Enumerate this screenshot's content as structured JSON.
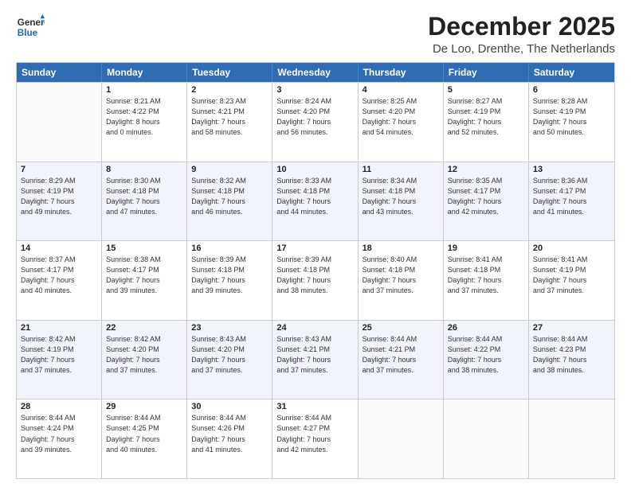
{
  "header": {
    "logo_general": "General",
    "logo_blue": "Blue",
    "title": "December 2025",
    "subtitle": "De Loo, Drenthe, The Netherlands"
  },
  "days_of_week": [
    "Sunday",
    "Monday",
    "Tuesday",
    "Wednesday",
    "Thursday",
    "Friday",
    "Saturday"
  ],
  "weeks": [
    [
      {
        "day": "",
        "info": ""
      },
      {
        "day": "1",
        "info": "Sunrise: 8:21 AM\nSunset: 4:22 PM\nDaylight: 8 hours\nand 0 minutes."
      },
      {
        "day": "2",
        "info": "Sunrise: 8:23 AM\nSunset: 4:21 PM\nDaylight: 7 hours\nand 58 minutes."
      },
      {
        "day": "3",
        "info": "Sunrise: 8:24 AM\nSunset: 4:20 PM\nDaylight: 7 hours\nand 56 minutes."
      },
      {
        "day": "4",
        "info": "Sunrise: 8:25 AM\nSunset: 4:20 PM\nDaylight: 7 hours\nand 54 minutes."
      },
      {
        "day": "5",
        "info": "Sunrise: 8:27 AM\nSunset: 4:19 PM\nDaylight: 7 hours\nand 52 minutes."
      },
      {
        "day": "6",
        "info": "Sunrise: 8:28 AM\nSunset: 4:19 PM\nDaylight: 7 hours\nand 50 minutes."
      }
    ],
    [
      {
        "day": "7",
        "info": "Sunrise: 8:29 AM\nSunset: 4:19 PM\nDaylight: 7 hours\nand 49 minutes."
      },
      {
        "day": "8",
        "info": "Sunrise: 8:30 AM\nSunset: 4:18 PM\nDaylight: 7 hours\nand 47 minutes."
      },
      {
        "day": "9",
        "info": "Sunrise: 8:32 AM\nSunset: 4:18 PM\nDaylight: 7 hours\nand 46 minutes."
      },
      {
        "day": "10",
        "info": "Sunrise: 8:33 AM\nSunset: 4:18 PM\nDaylight: 7 hours\nand 44 minutes."
      },
      {
        "day": "11",
        "info": "Sunrise: 8:34 AM\nSunset: 4:18 PM\nDaylight: 7 hours\nand 43 minutes."
      },
      {
        "day": "12",
        "info": "Sunrise: 8:35 AM\nSunset: 4:17 PM\nDaylight: 7 hours\nand 42 minutes."
      },
      {
        "day": "13",
        "info": "Sunrise: 8:36 AM\nSunset: 4:17 PM\nDaylight: 7 hours\nand 41 minutes."
      }
    ],
    [
      {
        "day": "14",
        "info": "Sunrise: 8:37 AM\nSunset: 4:17 PM\nDaylight: 7 hours\nand 40 minutes."
      },
      {
        "day": "15",
        "info": "Sunrise: 8:38 AM\nSunset: 4:17 PM\nDaylight: 7 hours\nand 39 minutes."
      },
      {
        "day": "16",
        "info": "Sunrise: 8:39 AM\nSunset: 4:18 PM\nDaylight: 7 hours\nand 39 minutes."
      },
      {
        "day": "17",
        "info": "Sunrise: 8:39 AM\nSunset: 4:18 PM\nDaylight: 7 hours\nand 38 minutes."
      },
      {
        "day": "18",
        "info": "Sunrise: 8:40 AM\nSunset: 4:18 PM\nDaylight: 7 hours\nand 37 minutes."
      },
      {
        "day": "19",
        "info": "Sunrise: 8:41 AM\nSunset: 4:18 PM\nDaylight: 7 hours\nand 37 minutes."
      },
      {
        "day": "20",
        "info": "Sunrise: 8:41 AM\nSunset: 4:19 PM\nDaylight: 7 hours\nand 37 minutes."
      }
    ],
    [
      {
        "day": "21",
        "info": "Sunrise: 8:42 AM\nSunset: 4:19 PM\nDaylight: 7 hours\nand 37 minutes."
      },
      {
        "day": "22",
        "info": "Sunrise: 8:42 AM\nSunset: 4:20 PM\nDaylight: 7 hours\nand 37 minutes."
      },
      {
        "day": "23",
        "info": "Sunrise: 8:43 AM\nSunset: 4:20 PM\nDaylight: 7 hours\nand 37 minutes."
      },
      {
        "day": "24",
        "info": "Sunrise: 8:43 AM\nSunset: 4:21 PM\nDaylight: 7 hours\nand 37 minutes."
      },
      {
        "day": "25",
        "info": "Sunrise: 8:44 AM\nSunset: 4:21 PM\nDaylight: 7 hours\nand 37 minutes."
      },
      {
        "day": "26",
        "info": "Sunrise: 8:44 AM\nSunset: 4:22 PM\nDaylight: 7 hours\nand 38 minutes."
      },
      {
        "day": "27",
        "info": "Sunrise: 8:44 AM\nSunset: 4:23 PM\nDaylight: 7 hours\nand 38 minutes."
      }
    ],
    [
      {
        "day": "28",
        "info": "Sunrise: 8:44 AM\nSunset: 4:24 PM\nDaylight: 7 hours\nand 39 minutes."
      },
      {
        "day": "29",
        "info": "Sunrise: 8:44 AM\nSunset: 4:25 PM\nDaylight: 7 hours\nand 40 minutes."
      },
      {
        "day": "30",
        "info": "Sunrise: 8:44 AM\nSunset: 4:26 PM\nDaylight: 7 hours\nand 41 minutes."
      },
      {
        "day": "31",
        "info": "Sunrise: 8:44 AM\nSunset: 4:27 PM\nDaylight: 7 hours\nand 42 minutes."
      },
      {
        "day": "",
        "info": ""
      },
      {
        "day": "",
        "info": ""
      },
      {
        "day": "",
        "info": ""
      }
    ]
  ]
}
